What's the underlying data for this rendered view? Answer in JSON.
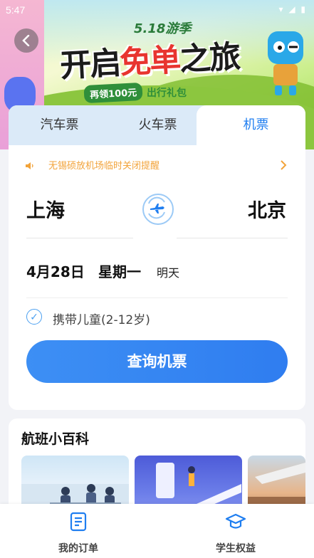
{
  "status_bar": {
    "time": "5:47",
    "right_icons": "▾ ◢ ▮"
  },
  "banner": {
    "festival": "5.18游季",
    "title_a": "开启",
    "title_b": "免单",
    "title_c": "之旅",
    "subtitle_pill": "再领100元",
    "subtitle_text": "出行礼包"
  },
  "tabs": [
    {
      "label": "汽车票"
    },
    {
      "label": "火车票"
    },
    {
      "label": "机票",
      "active": true
    }
  ],
  "notice": {
    "text": "无锡硕放机场临时关闭提醒"
  },
  "route": {
    "from": "上海",
    "to": "北京"
  },
  "date": {
    "date": "4月28日",
    "weekday": "星期一",
    "relative": "明天"
  },
  "options": {
    "child_label": "携带儿童(2-12岁)",
    "child_checked": true
  },
  "search": {
    "label": "查询机票"
  },
  "wiki": {
    "title": "航班小百科"
  },
  "bottom_nav": [
    {
      "label": "我的订单",
      "icon": "document-icon"
    },
    {
      "label": "学生权益",
      "icon": "graduation-cap-icon"
    }
  ],
  "colors": {
    "accent": "#1f7ef0",
    "notice": "#f2a33a",
    "tab_bg": "#dbeaf8"
  }
}
